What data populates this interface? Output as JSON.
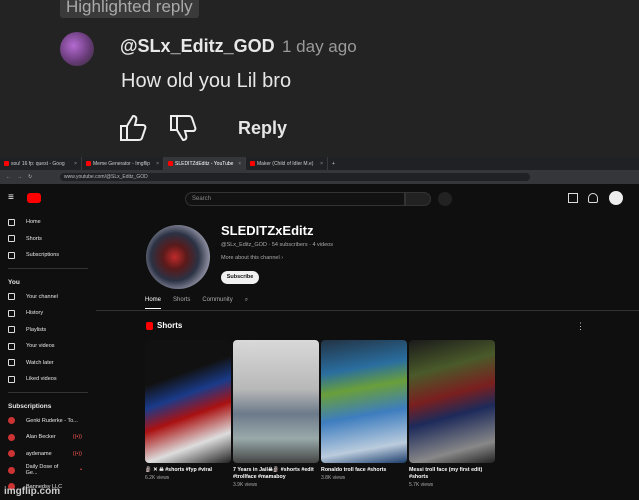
{
  "comment": {
    "badge": "Highlighted reply",
    "author": "@SLx_Editz_GOD",
    "time": "1 day ago",
    "text": "How old you Lil bro",
    "reply_label": "Reply"
  },
  "browser": {
    "tabs": [
      {
        "label": "sou! 16 fp: quest - Goog"
      },
      {
        "label": "Meme Generator - Imgflip"
      },
      {
        "label": "SLEDITZdEditz - YouTube"
      },
      {
        "label": "Maker (Child of Idler M.e)"
      }
    ],
    "new_tab": "+",
    "url": "www.youtube.com/@SLx_Editz_GOD"
  },
  "youtube": {
    "search_placeholder": "Search",
    "sidebar": {
      "main": [
        "Home",
        "Shorts",
        "Subscriptions"
      ],
      "you_header": "You",
      "you_items": [
        "Your channel",
        "History",
        "Playlists",
        "Your videos",
        "Watch later",
        "Liked videos"
      ],
      "subs_header": "Subscriptions",
      "subs": [
        "Genki Ruderke - To...",
        "Alan Becker",
        "aydename",
        "Daily Dose of Ge...",
        "Bannedsy LLC"
      ]
    },
    "channel": {
      "name": "SLEDITZxEditz",
      "meta": "@SLx_Editz_GOD · 54 subscribers · 4 videos",
      "more": "More about this channel",
      "subscribe": "Subscribe",
      "tabs": [
        "Home",
        "Shorts",
        "Community"
      ]
    },
    "shorts_header": "Shorts",
    "shorts": [
      {
        "title": "🗿 ✕ ☠ #shorts #fyp #viral",
        "views": "6.2K views"
      },
      {
        "title": "7 Years in Jail☠🗿 #shorts #edit #trollface #mamaboy",
        "views": "3.9K views"
      },
      {
        "title": "Ronaldo troll face #shorts",
        "views": "3.8K views"
      },
      {
        "title": "Messi troll face (my first edit) #shorts",
        "views": "5.7K views"
      }
    ]
  },
  "watermark": "imgflip.com"
}
